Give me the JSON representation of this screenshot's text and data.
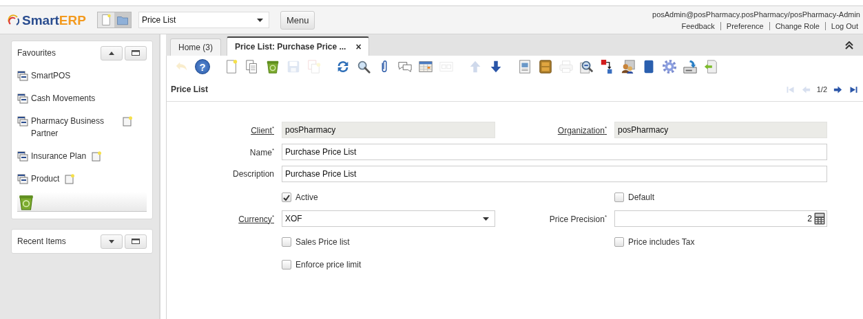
{
  "header": {
    "logo": {
      "part_1": "Smart",
      "part_2": "ERP"
    },
    "quick_buttons": [
      {
        "kind": "new",
        "selected": false
      },
      {
        "kind": "folder",
        "selected": true
      }
    ],
    "window_select": {
      "value": "Price List"
    },
    "menu_button": "Menu",
    "user": "posAdmin@posPharmacy.posPharmacy/posPharmacy-Admin",
    "links": [
      "Feedback",
      "Preference",
      "Change Role",
      "Log Out"
    ]
  },
  "sidebar": {
    "panels": [
      {
        "title": "Favourites",
        "expanded": true,
        "items": [
          {
            "label": "SmartPOS",
            "new_icon": false
          },
          {
            "label": "Cash Movements",
            "new_icon": false
          },
          {
            "label": "Pharmacy Business Partner",
            "new_icon": true
          },
          {
            "label": "Insurance Plan",
            "new_icon": true
          },
          {
            "label": "Product",
            "new_icon": true
          }
        ]
      },
      {
        "title": "Recent Items",
        "expanded": false
      }
    ]
  },
  "tabs": [
    {
      "label": "Home (3)",
      "selected": false
    },
    {
      "label": "Price List: Purchase Price ...",
      "selected": true,
      "close": "×"
    }
  ],
  "toolbar": {
    "groups": [
      [
        {
          "kind": "undo",
          "disabled": true
        },
        {
          "kind": "help",
          "disabled": false,
          "glyph": "?"
        }
      ],
      [
        {
          "kind": "new",
          "disabled": false
        },
        {
          "kind": "copy",
          "disabled": false
        },
        {
          "kind": "delete",
          "disabled": false
        },
        {
          "kind": "save",
          "disabled": true
        },
        {
          "kind": "savenew",
          "disabled": true
        }
      ],
      [
        {
          "kind": "refresh",
          "disabled": false
        },
        {
          "kind": "find",
          "disabled": false
        },
        {
          "kind": "attach",
          "disabled": false
        },
        {
          "kind": "chat",
          "disabled": false
        },
        {
          "kind": "grid",
          "disabled": false
        },
        {
          "kind": "multi",
          "disabled": true
        }
      ],
      [
        {
          "kind": "up",
          "disabled": true
        },
        {
          "kind": "down",
          "disabled": false
        }
      ],
      [
        {
          "kind": "report",
          "disabled": false
        },
        {
          "kind": "archive",
          "disabled": false
        },
        {
          "kind": "print",
          "disabled": true
        },
        {
          "kind": "zoom",
          "disabled": false
        },
        {
          "kind": "requests",
          "disabled": false
        },
        {
          "kind": "workflow",
          "disabled": false
        },
        {
          "kind": "block",
          "disabled": false
        },
        {
          "kind": "process",
          "disabled": false
        },
        {
          "kind": "export",
          "disabled": false
        },
        {
          "kind": "import",
          "disabled": false
        }
      ]
    ]
  },
  "window": {
    "title": "Price List",
    "record": "1/2",
    "nav": [
      {
        "kind": "first",
        "disabled": true
      },
      {
        "kind": "previous",
        "disabled": true
      },
      {
        "kind": "next",
        "disabled": false
      },
      {
        "kind": "last",
        "disabled": false
      }
    ]
  },
  "form": {
    "rows": [
      [
        {
          "kind": "text",
          "label": "Client$^{*}$",
          "link": true,
          "value": "posPharmacy",
          "readonly": true
        },
        {
          "kind": "text",
          "label": "Organization$^{*}$",
          "link": true,
          "value": "posPharmacy",
          "readonly": true
        }
      ],
      [
        {
          "kind": "text",
          "label": "Name$^{*}$",
          "link": false,
          "value": "Purchase Price List",
          "readonly": false,
          "wide": true
        }
      ],
      [
        {
          "kind": "text",
          "label": "Description",
          "link": false,
          "value": "Purchase Price List",
          "readonly": false,
          "wide": true
        }
      ],
      [
        {
          "kind": "checkbox",
          "label": "Active",
          "checked": true
        },
        {
          "kind": "checkbox",
          "label": "Default",
          "checked": false
        }
      ],
      [
        {
          "kind": "select",
          "label": "Currency$^{*}$",
          "link": true,
          "value": "XOF",
          "readonly": false
        },
        {
          "kind": "number",
          "label": "Price Precision$^{*}$",
          "link": false,
          "value": "2",
          "readonly": false
        }
      ],
      [
        {
          "kind": "checkbox",
          "label": "Sales Price list",
          "checked": false
        },
        {
          "kind": "checkbox",
          "label": "Price includes Tax",
          "checked": false
        }
      ],
      [
        {
          "kind": "checkbox",
          "label": "Enforce price limit",
          "checked": false
        }
      ]
    ]
  }
}
